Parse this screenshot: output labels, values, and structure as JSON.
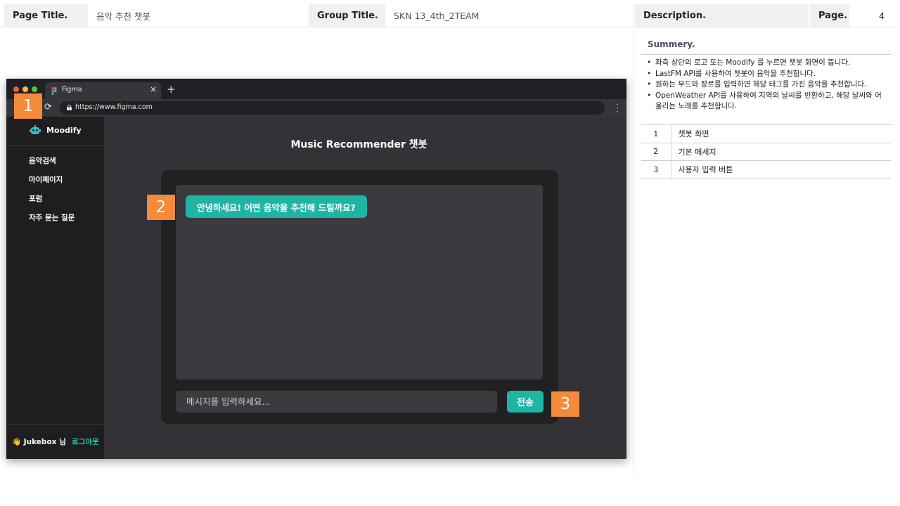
{
  "header": {
    "page_title_label": "Page Title.",
    "page_title_value": "음악 추천 챗봇",
    "group_title_label": "Group Title.",
    "group_title_value": "SKN 13_4th_2TEAM",
    "description_label": "Description.",
    "page_label": "Page.",
    "page_value": "4"
  },
  "summary": {
    "title": "Summery.",
    "bullets": [
      "좌측 상단의 로고 또는 Moodify 를 누르면 챗봇 화면이 뜹니다.",
      "LastFM API를 사용하여 챗봇이 음악을 추천합니다.",
      "원하는 무드와 장르를 입력하면 해당 태그를 가진 음악을 추천합니다.",
      "OpenWeather API를 사용하여 지역의 날씨를 반환하고, 해당 날씨와 어울리는 노래를 추천합니다."
    ]
  },
  "desc_table": [
    {
      "num": "1",
      "text": "챗봇 화면"
    },
    {
      "num": "2",
      "text": "기본 메세지"
    },
    {
      "num": "3",
      "text": "사용자 입력 버튼"
    }
  ],
  "browser": {
    "tab_title": "Figma",
    "url": "https://www.figma.com"
  },
  "app": {
    "brand": "Moodify",
    "nav": [
      "음악검색",
      "마이페이지",
      "포럼",
      "자주 묻는 질문"
    ],
    "user": "👋 Jukebox 님",
    "logout": "로그아웃",
    "main_title": "Music Recommender 챗봇",
    "bot_message": "안녕하세요! 어떤 음악을 추천해 드릴까요?",
    "input_placeholder": "메시지를 입력하세요...",
    "send_label": "전송"
  },
  "markers": [
    "1",
    "2",
    "3"
  ],
  "colors": {
    "accent_teal": "#1fb5a4",
    "marker_orange": "#f58a3a",
    "sidebar_bg": "#1e1e21",
    "main_bg": "#323237"
  }
}
